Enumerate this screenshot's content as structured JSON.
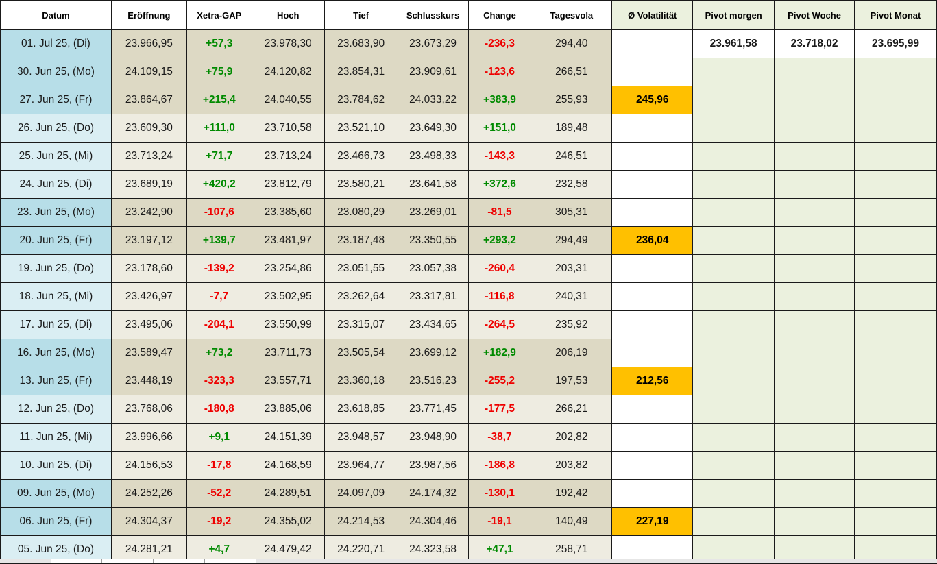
{
  "headers": [
    "Datum",
    "Eröffnung",
    "Xetra-GAP",
    "Hoch",
    "Tief",
    "Schlusskurs",
    "Change",
    "Tagesvola",
    "Ø Volatilität",
    "Pivot morgen",
    "Pivot Woche",
    "Pivot Monat"
  ],
  "pivots": {
    "morgen": "23.961,58",
    "woche": "23.718,02",
    "monat": "23.695,99"
  },
  "colors": {
    "date_weekday": "#daeef3",
    "date_monday_friday": "#b7dee8",
    "number_weekday": "#eeece1",
    "number_monday_friday": "#ddd9c4",
    "pivot_area": "#ebf1de",
    "volatility_highlight": "#ffc000",
    "positive": "#008a00",
    "negative": "#ee0000"
  },
  "rows": [
    {
      "datum": "01. Jul 25, (Di)",
      "eroeffnung": "23.966,95",
      "gap": "+57,3",
      "hoch": "23.978,30",
      "tief": "23.683,90",
      "schluss": "23.673,29",
      "change": "-236,3",
      "vola": "294,40",
      "avg_vola": ""
    },
    {
      "datum": "30. Jun 25, (Mo)",
      "eroeffnung": "24.109,15",
      "gap": "+75,9",
      "hoch": "24.120,82",
      "tief": "23.854,31",
      "schluss": "23.909,61",
      "change": "-123,6",
      "vola": "266,51",
      "avg_vola": ""
    },
    {
      "datum": "27. Jun 25, (Fr)",
      "eroeffnung": "23.864,67",
      "gap": "+215,4",
      "hoch": "24.040,55",
      "tief": "23.784,62",
      "schluss": "24.033,22",
      "change": "+383,9",
      "vola": "255,93",
      "avg_vola": "245,96"
    },
    {
      "datum": "26. Jun 25, (Do)",
      "eroeffnung": "23.609,30",
      "gap": "+111,0",
      "hoch": "23.710,58",
      "tief": "23.521,10",
      "schluss": "23.649,30",
      "change": "+151,0",
      "vola": "189,48",
      "avg_vola": ""
    },
    {
      "datum": "25. Jun 25, (Mi)",
      "eroeffnung": "23.713,24",
      "gap": "+71,7",
      "hoch": "23.713,24",
      "tief": "23.466,73",
      "schluss": "23.498,33",
      "change": "-143,3",
      "vola": "246,51",
      "avg_vola": ""
    },
    {
      "datum": "24. Jun 25, (Di)",
      "eroeffnung": "23.689,19",
      "gap": "+420,2",
      "hoch": "23.812,79",
      "tief": "23.580,21",
      "schluss": "23.641,58",
      "change": "+372,6",
      "vola": "232,58",
      "avg_vola": ""
    },
    {
      "datum": "23. Jun 25, (Mo)",
      "eroeffnung": "23.242,90",
      "gap": "-107,6",
      "hoch": "23.385,60",
      "tief": "23.080,29",
      "schluss": "23.269,01",
      "change": "-81,5",
      "vola": "305,31",
      "avg_vola": ""
    },
    {
      "datum": "20. Jun 25, (Fr)",
      "eroeffnung": "23.197,12",
      "gap": "+139,7",
      "hoch": "23.481,97",
      "tief": "23.187,48",
      "schluss": "23.350,55",
      "change": "+293,2",
      "vola": "294,49",
      "avg_vola": "236,04"
    },
    {
      "datum": "19. Jun 25, (Do)",
      "eroeffnung": "23.178,60",
      "gap": "-139,2",
      "hoch": "23.254,86",
      "tief": "23.051,55",
      "schluss": "23.057,38",
      "change": "-260,4",
      "vola": "203,31",
      "avg_vola": ""
    },
    {
      "datum": "18. Jun 25, (Mi)",
      "eroeffnung": "23.426,97",
      "gap": "-7,7",
      "hoch": "23.502,95",
      "tief": "23.262,64",
      "schluss": "23.317,81",
      "change": "-116,8",
      "vola": "240,31",
      "avg_vola": ""
    },
    {
      "datum": "17. Jun 25, (Di)",
      "eroeffnung": "23.495,06",
      "gap": "-204,1",
      "hoch": "23.550,99",
      "tief": "23.315,07",
      "schluss": "23.434,65",
      "change": "-264,5",
      "vola": "235,92",
      "avg_vola": ""
    },
    {
      "datum": "16. Jun 25, (Mo)",
      "eroeffnung": "23.589,47",
      "gap": "+73,2",
      "hoch": "23.711,73",
      "tief": "23.505,54",
      "schluss": "23.699,12",
      "change": "+182,9",
      "vola": "206,19",
      "avg_vola": ""
    },
    {
      "datum": "13. Jun 25, (Fr)",
      "eroeffnung": "23.448,19",
      "gap": "-323,3",
      "hoch": "23.557,71",
      "tief": "23.360,18",
      "schluss": "23.516,23",
      "change": "-255,2",
      "vola": "197,53",
      "avg_vola": "212,56"
    },
    {
      "datum": "12. Jun 25, (Do)",
      "eroeffnung": "23.768,06",
      "gap": "-180,8",
      "hoch": "23.885,06",
      "tief": "23.618,85",
      "schluss": "23.771,45",
      "change": "-177,5",
      "vola": "266,21",
      "avg_vola": ""
    },
    {
      "datum": "11. Jun 25, (Mi)",
      "eroeffnung": "23.996,66",
      "gap": "+9,1",
      "hoch": "24.151,39",
      "tief": "23.948,57",
      "schluss": "23.948,90",
      "change": "-38,7",
      "vola": "202,82",
      "avg_vola": ""
    },
    {
      "datum": "10. Jun 25, (Di)",
      "eroeffnung": "24.156,53",
      "gap": "-17,8",
      "hoch": "24.168,59",
      "tief": "23.964,77",
      "schluss": "23.987,56",
      "change": "-186,8",
      "vola": "203,82",
      "avg_vola": ""
    },
    {
      "datum": "09. Jun 25, (Mo)",
      "eroeffnung": "24.252,26",
      "gap": "-52,2",
      "hoch": "24.289,51",
      "tief": "24.097,09",
      "schluss": "24.174,32",
      "change": "-130,1",
      "vola": "192,42",
      "avg_vola": ""
    },
    {
      "datum": "06. Jun 25, (Fr)",
      "eroeffnung": "24.304,37",
      "gap": "-19,2",
      "hoch": "24.355,02",
      "tief": "24.214,53",
      "schluss": "24.304,46",
      "change": "-19,1",
      "vola": "140,49",
      "avg_vola": "227,19"
    },
    {
      "datum": "05. Jun 25, (Do)",
      "eroeffnung": "24.281,21",
      "gap": "+4,7",
      "hoch": "24.479,42",
      "tief": "24.220,71",
      "schluss": "24.323,58",
      "change": "+47,1",
      "vola": "258,71",
      "avg_vola": ""
    }
  ]
}
